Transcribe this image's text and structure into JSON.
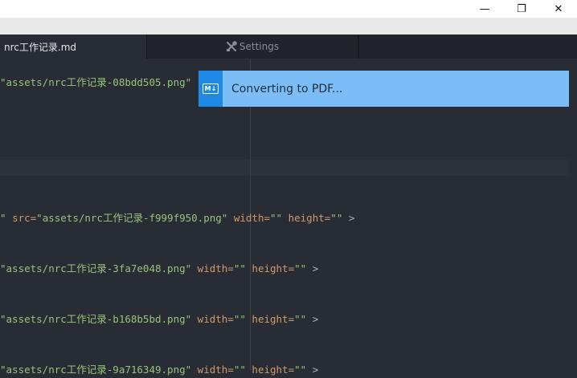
{
  "window": {
    "minimize_glyph": "—",
    "restore_glyph": "❐",
    "close_glyph": "✕"
  },
  "tabs": [
    {
      "label": "nrc工作记录.md"
    },
    {
      "label": "Settings",
      "icon": "tools-icon"
    }
  ],
  "editor_lines": [
    {
      "s1": "\"assets/nrc工作记录-08bdd505.png\""
    },
    {
      "p0": "\" ",
      "a1": "src=",
      "s1": "\"assets/nrc工作记录-f999f950.png\"",
      "a2": " width=",
      "s2": "\"\"",
      "a3": " height=",
      "s3": "\"\"",
      "p1": " >"
    },
    {
      "s1": "\"assets/nrc工作记录-3fa7e048.png\"",
      "a2": " width=",
      "s2": "\"\"",
      "a3": " height=",
      "s3": "\"\"",
      "p1": " >"
    },
    {
      "s1": "\"assets/nrc工作记录-b168b5bd.png\"",
      "a2": " width=",
      "s2": "\"\"",
      "a3": " height=",
      "s3": "\"\"",
      "p1": " >"
    },
    {
      "s1": "\"assets/nrc工作记录-9a716349.png\"",
      "a2": " width=",
      "s2": "\"\"",
      "a3": " height=",
      "s3": "\"\"",
      "p1": " >"
    }
  ],
  "notification": {
    "icon_label": "M↓",
    "message": "Converting to PDF..."
  },
  "colors": {
    "editor_bg": "#282c34",
    "string": "#98c379",
    "attribute": "#d19a66",
    "toast_bg": "#7bbdf7",
    "toast_icon_bg": "#1e88e5"
  }
}
